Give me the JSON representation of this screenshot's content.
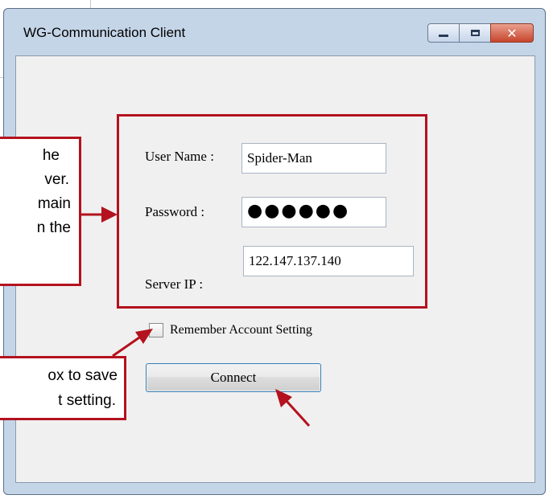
{
  "window": {
    "title": "WG-Communication Client",
    "close_glyph": "✕"
  },
  "form": {
    "username_label": "User Name :",
    "username_value": "Spider-Man",
    "password_label": "Password :",
    "password_value": "●●●●●●",
    "server_ip_label": "Server IP :",
    "server_ip_value": "122.147.137.140",
    "remember_label": "Remember Account Setting",
    "connect_label": "Connect"
  },
  "callouts": {
    "top_lines": [
      "he",
      "ver.",
      "main",
      "n the"
    ],
    "bottom_lines": [
      "ox to save",
      "t setting."
    ]
  },
  "colors": {
    "annotation": "#b3121e",
    "window_frame": "#c5d5e8",
    "client_bg": "#f0f0f0"
  }
}
